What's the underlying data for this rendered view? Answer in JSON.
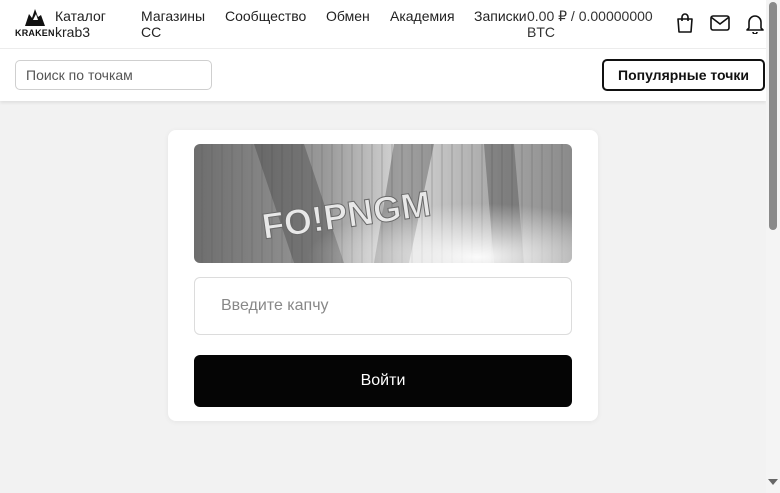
{
  "header": {
    "logo_text": "KRAKEN",
    "catalog_label": "Каталог",
    "catalog_sub": "krab3",
    "nav": [
      {
        "label": "Магазины",
        "sub": "СС"
      },
      {
        "label": "Сообщество"
      },
      {
        "label": "Обмен"
      },
      {
        "label": "Академия"
      },
      {
        "label": "Записки"
      }
    ],
    "balance": "0.00 ₽ / 0.00000000 BTC",
    "icons": [
      "bag-icon",
      "mail-icon",
      "bell-icon"
    ]
  },
  "toolbar": {
    "search_placeholder": "Поиск по точкам",
    "popular_label": "Популярные точки"
  },
  "form": {
    "captcha_text": "FO!PNGM",
    "captcha_placeholder": "Введите капчу",
    "login_label": "Войти"
  },
  "colors": {
    "page_bg": "#f2f2f2",
    "button_bg": "#050505",
    "button_text": "#ffffff"
  }
}
